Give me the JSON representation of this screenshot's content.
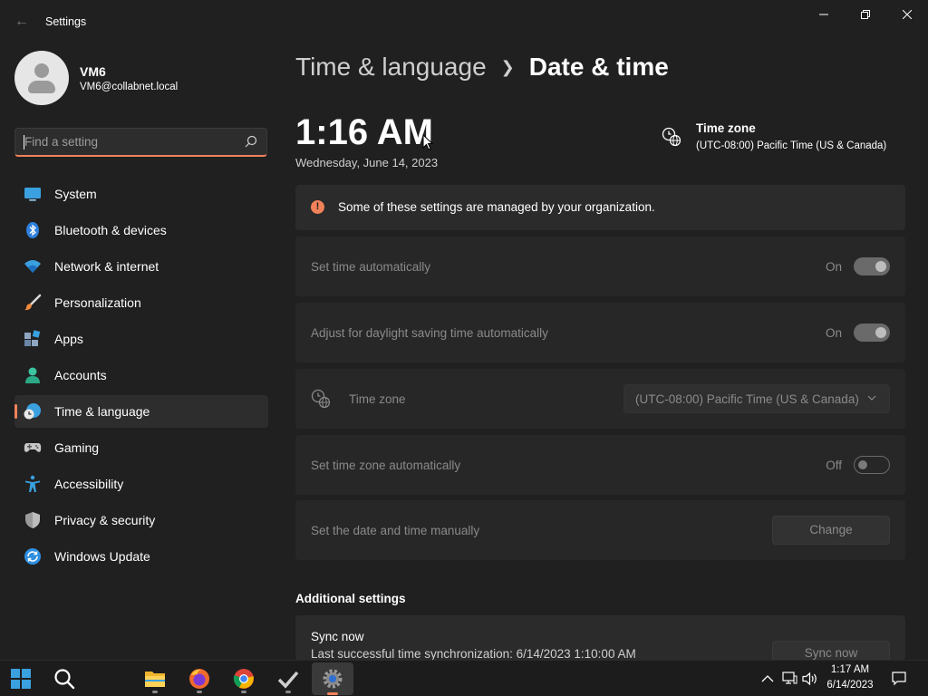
{
  "window": {
    "title": "Settings"
  },
  "profile": {
    "name": "VM6",
    "email": "VM6@collabnet.local"
  },
  "search": {
    "placeholder": "Find a setting"
  },
  "sidebar": {
    "items": [
      {
        "label": "System",
        "icon": "system-icon",
        "active": false
      },
      {
        "label": "Bluetooth & devices",
        "icon": "bluetooth-icon",
        "active": false
      },
      {
        "label": "Network & internet",
        "icon": "wifi-icon",
        "active": false
      },
      {
        "label": "Personalization",
        "icon": "brush-icon",
        "active": false
      },
      {
        "label": "Apps",
        "icon": "apps-icon",
        "active": false
      },
      {
        "label": "Accounts",
        "icon": "person-icon",
        "active": false
      },
      {
        "label": "Time & language",
        "icon": "clock-globe-icon",
        "active": true
      },
      {
        "label": "Gaming",
        "icon": "gamepad-icon",
        "active": false
      },
      {
        "label": "Accessibility",
        "icon": "accessibility-icon",
        "active": false
      },
      {
        "label": "Privacy & security",
        "icon": "shield-icon",
        "active": false
      },
      {
        "label": "Windows Update",
        "icon": "update-icon",
        "active": false
      }
    ]
  },
  "header": {
    "breadcrumb_parent": "Time & language",
    "breadcrumb_current": "Date & time"
  },
  "clock": {
    "time": "1:16 AM",
    "date": "Wednesday, June 14, 2023"
  },
  "timezone_summary": {
    "title": "Time zone",
    "value": "(UTC-08:00) Pacific Time (US & Canada)"
  },
  "notice": {
    "text": "Some of these settings are managed by your organization."
  },
  "settings": {
    "set_time_auto": {
      "label": "Set time automatically",
      "state": "On"
    },
    "daylight_saving": {
      "label": "Adjust for daylight saving time automatically",
      "state": "On"
    },
    "time_zone": {
      "label": "Time zone",
      "value": "(UTC-08:00) Pacific Time (US & Canada)"
    },
    "set_tz_auto": {
      "label": "Set time zone automatically",
      "state": "Off"
    },
    "manual": {
      "label": "Set the date and time manually",
      "button": "Change"
    }
  },
  "additional": {
    "title": "Additional settings",
    "sync_title": "Sync now",
    "sync_subtitle": "Last successful time synchronization: 6/14/2023 1:10:00 AM",
    "sync_button": "Sync now"
  },
  "taskbar": {
    "time": "1:17 AM",
    "date": "6/14/2023"
  },
  "colors": {
    "accent": "#f0825a",
    "background": "#202020",
    "card": "#2b2b2b"
  }
}
